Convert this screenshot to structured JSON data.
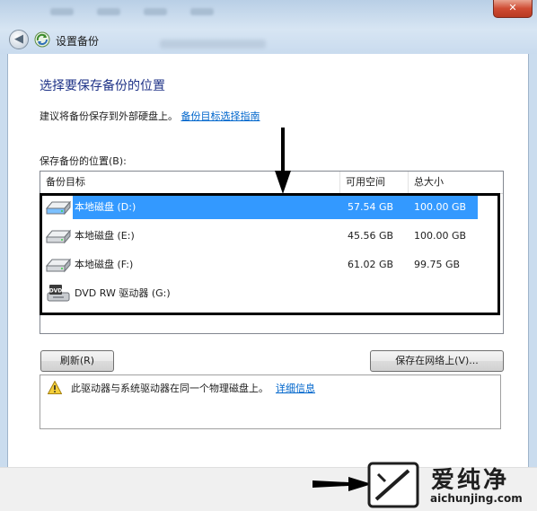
{
  "window": {
    "title": "设置备份",
    "close_glyph": "✕",
    "back_glyph": "◀"
  },
  "page": {
    "heading": "选择要保存备份的位置",
    "hint_text": "建议将备份保存到外部硬盘上。",
    "hint_link": "备份目标选择指南",
    "list_label": "保存备份的位置(B):"
  },
  "list": {
    "columns": [
      "备份目标",
      "可用空间",
      "总大小"
    ],
    "rows": [
      {
        "name": "本地磁盘 (D:)",
        "free": "57.54 GB",
        "size": "100.00 GB",
        "icon": "hard-disk-icon",
        "selected": true
      },
      {
        "name": "本地磁盘 (E:)",
        "free": "45.56 GB",
        "size": "100.00 GB",
        "icon": "hard-disk-icon",
        "selected": false
      },
      {
        "name": "本地磁盘 (F:)",
        "free": "61.02 GB",
        "size": "99.75 GB",
        "icon": "hard-disk-icon",
        "selected": false
      },
      {
        "name": "DVD RW 驱动器 (G:)",
        "free": "",
        "size": "",
        "icon": "dvd-drive-icon",
        "selected": false
      }
    ]
  },
  "buttons": {
    "refresh": "刷新(R)",
    "save_network": "保存在网络上(V)..."
  },
  "warning": {
    "text": "此驱动器与系统驱动器在同一个物理磁盘上。",
    "link": "详细信息",
    "icon": "warning-icon"
  },
  "watermark": {
    "brand": "爱纯净",
    "url": "aichunjing.com"
  },
  "colors": {
    "heading": "#1e3287",
    "link": "#0066cc",
    "selection": "#3399ff"
  }
}
